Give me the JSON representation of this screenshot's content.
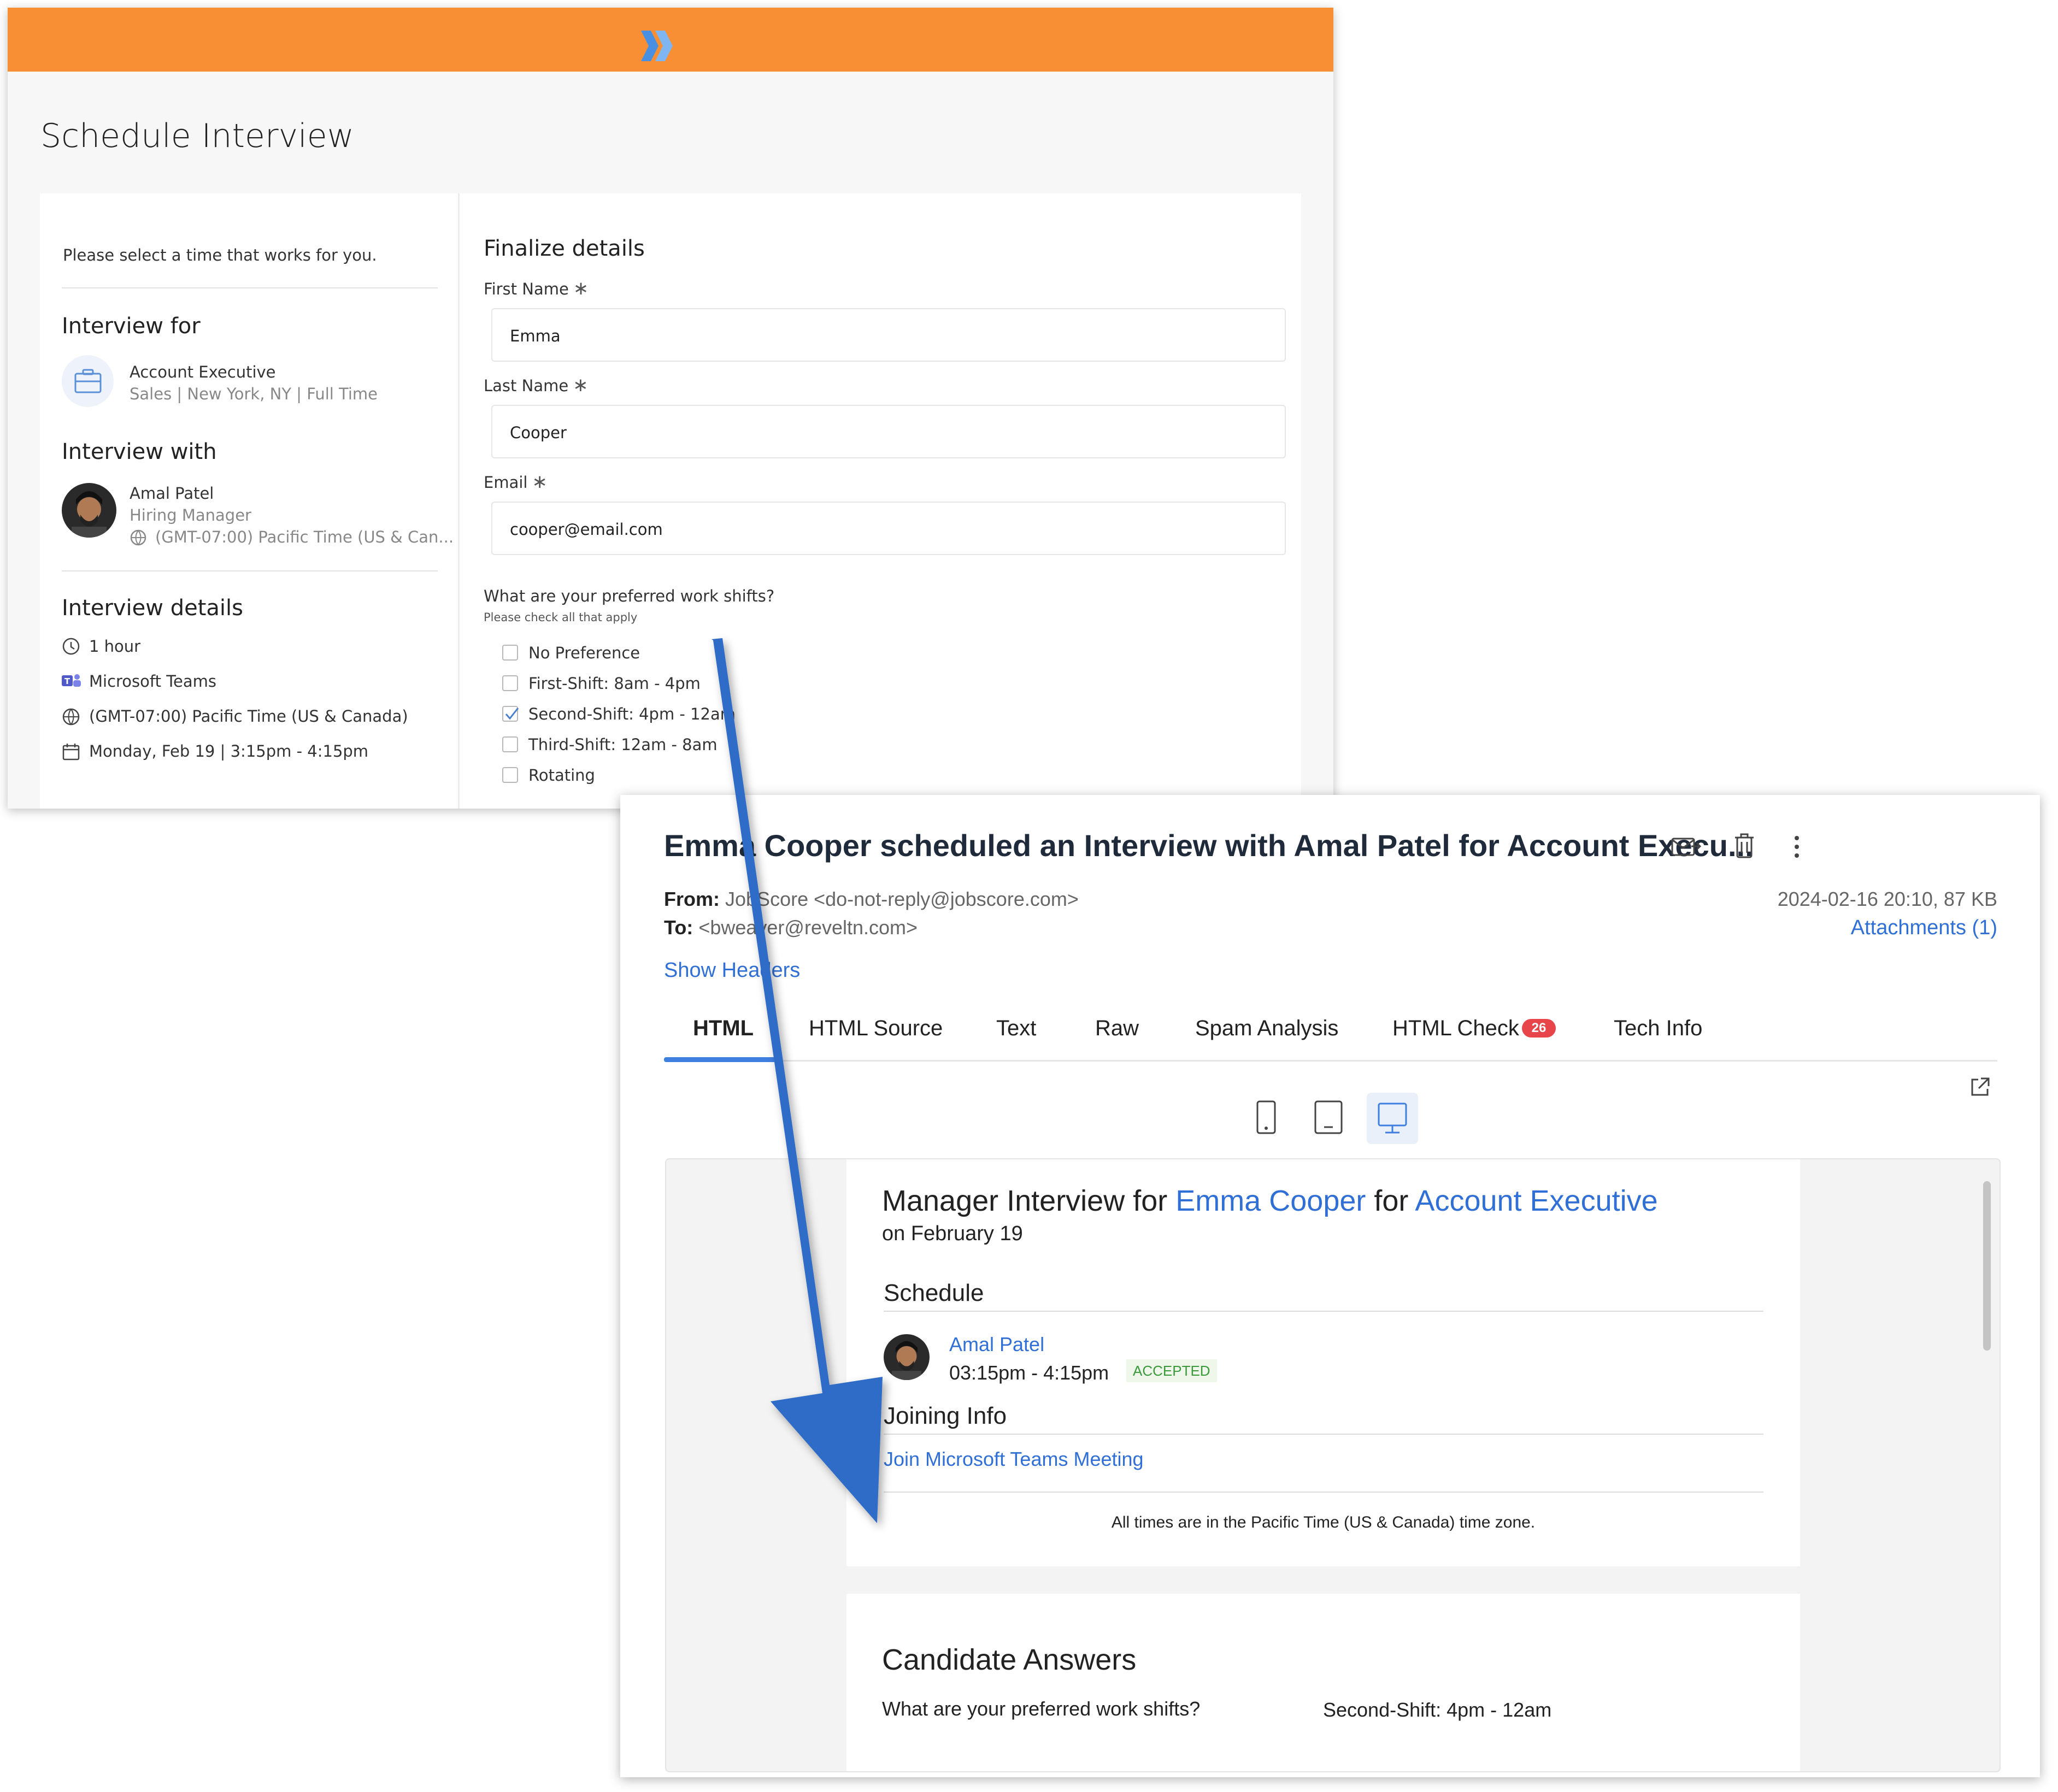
{
  "schedule": {
    "title": "Schedule Interview",
    "prompt": "Please select a time that works for you.",
    "interview_for_heading": "Interview for",
    "job_title": "Account Executive",
    "job_meta": "Sales | New York, NY | Full Time",
    "interview_with_heading": "Interview with",
    "interviewer_name": "Amal Patel",
    "interviewer_role": "Hiring Manager",
    "interviewer_tz": "(GMT-07:00) Pacific Time (US & Can...",
    "details_heading": "Interview details",
    "duration": "1 hour",
    "platform": "Microsoft Teams",
    "timezone": "(GMT-07:00) Pacific Time (US & Canada)",
    "datetime": "Monday, Feb 19 | 3:15pm - 4:15pm",
    "finalize_heading": "Finalize details",
    "first_name_label": "First Name",
    "first_name_value": "Emma",
    "last_name_label": "Last Name",
    "last_name_value": "Cooper",
    "email_label": "Email",
    "email_value": "cooper@email.com",
    "required_mark": "∗",
    "shifts_question": "What are your preferred work shifts?",
    "shifts_hint": "Please check all that apply",
    "shift_options": [
      {
        "label": "No Preference",
        "checked": false
      },
      {
        "label": "First-Shift: 8am - 4pm",
        "checked": false
      },
      {
        "label": "Second-Shift: 4pm - 12am",
        "checked": true
      },
      {
        "label": "Third-Shift: 12am - 8am",
        "checked": false
      },
      {
        "label": "Rotating",
        "checked": false
      }
    ]
  },
  "email": {
    "subject": "Emma Cooper scheduled an Interview with Amal Patel for Account Execu...",
    "from_label": "From:",
    "from_value": "JobScore <do-not-reply@jobscore.com>",
    "to_label": "To:",
    "to_value": "<bweaver@reveltn.com>",
    "date_size": "2024-02-16 20:10, 87 KB",
    "attachments": "Attachments (1)",
    "show_headers": "Show Headers",
    "tabs": [
      "HTML",
      "HTML Source",
      "Text",
      "Raw",
      "Spam Analysis",
      "HTML Check",
      "Tech Info"
    ],
    "html_check_badge": "26",
    "active_tab": "HTML",
    "body": {
      "heading_prefix": "Manager Interview for ",
      "candidate": "Emma Cooper",
      "heading_mid": " for ",
      "job": "Account Executive",
      "date_line": "on February 19",
      "schedule_heading": "Schedule",
      "interviewer": "Amal Patel",
      "time": "03:15pm - 4:15pm",
      "status": "ACCEPTED",
      "joining_heading": "Joining Info",
      "join_link": "Join Microsoft Teams Meeting",
      "tz_note": "All times are in the Pacific Time (US & Canada) time zone.",
      "answers_heading": "Candidate Answers",
      "question": "What are your preferred work shifts?",
      "answer": "Second-Shift: 4pm - 12am"
    }
  },
  "colors": {
    "topbar": "#f98f35",
    "link": "#2f6fd6",
    "arrow": "#2e6cc7",
    "accepted_text": "#3a9a3a",
    "badge": "#e8454a"
  }
}
